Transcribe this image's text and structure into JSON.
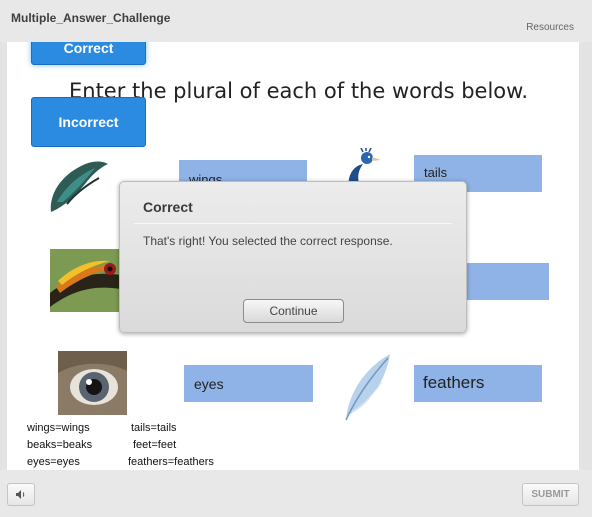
{
  "header": {
    "title": "Multiple_Answer_Challenge",
    "resources_label": "Resources"
  },
  "slide": {
    "correct_button": "Correct",
    "incorrect_button": "Incorrect",
    "instructions": "Enter the plural of each of the words below.",
    "answers": {
      "wings": "wings",
      "tails": "tails",
      "beaks": "",
      "eyes": "eyes",
      "feathers": "feathers"
    },
    "answer_key": [
      "wings=wings",
      "tails=tails",
      "beaks=beaks",
      "feet=feet",
      "eyes=eyes",
      "feathers=feathers"
    ]
  },
  "dialog": {
    "title": "Correct",
    "message": "That's right!  You selected the correct response.",
    "continue_label": "Continue"
  },
  "footer": {
    "audio_icon": "speaker-icon",
    "submit_label": "SUBMIT"
  },
  "colors": {
    "accent_blue": "#2a8be0",
    "answer_fill": "#8fb3e6"
  }
}
